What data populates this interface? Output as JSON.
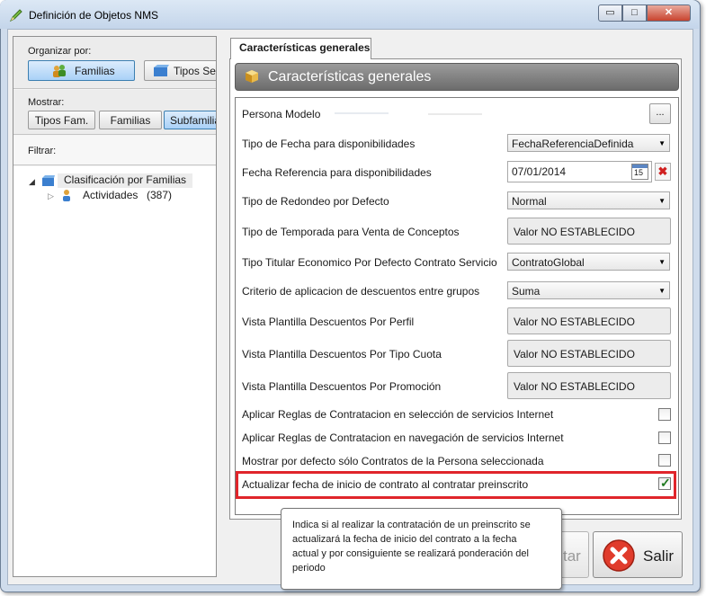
{
  "window": {
    "title": "Definición de Objetos NMS",
    "min_label": "▭",
    "max_label": "□",
    "close_label": "✕"
  },
  "left": {
    "organizar_label": "Organizar por:",
    "organizar_buttons": [
      "Familias",
      "Tipos Ser"
    ],
    "mostrar_label": "Mostrar:",
    "mostrar_buttons": [
      "Tipos Fam.",
      "Familias",
      "Subfamilia"
    ],
    "filtrar_label": "Filtrar:",
    "tree": {
      "root": "Clasificación por Familias",
      "child_name": "Actividades",
      "child_count": "(387)"
    }
  },
  "tab": {
    "label": "Características generales"
  },
  "panel": {
    "header": "Características generales",
    "persona_modelo": {
      "label": "Persona Modelo",
      "button": "..."
    },
    "tipo_fecha": {
      "label": "Tipo de Fecha para disponibilidades",
      "value": "FechaReferenciaDefinida"
    },
    "fecha_referencia": {
      "label": "Fecha Referencia para disponibilidades",
      "value": "07/01/2014",
      "calendar_day": "15"
    },
    "tipo_redondeo": {
      "label": "Tipo de Redondeo por Defecto",
      "value": "Normal"
    },
    "tipo_temporada": {
      "label": "Tipo de Temporada para Venta de Conceptos",
      "value": "Valor NO ESTABLECIDO"
    },
    "tipo_titular": {
      "label": "Tipo Titular Economico Por Defecto Contrato Servicio",
      "value": "ContratoGlobal"
    },
    "criterio_descuentos": {
      "label": "Criterio de aplicacion de descuentos entre grupos",
      "value": "Suma"
    },
    "vista_perfil": {
      "label": "Vista Plantilla Descuentos Por Perfil",
      "value": "Valor NO ESTABLECIDO"
    },
    "vista_cuota": {
      "label": "Vista Plantilla Descuentos Por Tipo Cuota",
      "value": "Valor NO ESTABLECIDO"
    },
    "vista_promocion": {
      "label": "Vista Plantilla Descuentos Por Promoción",
      "value": "Valor NO ESTABLECIDO"
    },
    "reglas_seleccion": {
      "label": "Aplicar Reglas de Contratacion en selección de servicios Internet",
      "checked": false
    },
    "reglas_navegacion": {
      "label": "Aplicar Reglas de Contratacion en navegación de servicios Internet",
      "checked": false
    },
    "mostrar_contratos": {
      "label": "Mostrar por defecto sólo Contratos de la Persona seleccionada",
      "checked": false
    },
    "actualizar_fecha": {
      "label": "Actualizar fecha de inicio de contrato al contratar preinscrito",
      "checked": true
    }
  },
  "footer": {
    "hidden_button_fragment": "tar",
    "salir_label": "Salir"
  },
  "tooltip": {
    "lines": [
      "Indica si al realizar la contratación de un preinscrito se",
      "actualizará la fecha de inicio del contrato a la fecha",
      "actual y por consiguiente se realizará ponderación del",
      "periodo"
    ]
  },
  "colors": {
    "accent_highlight": "#e0252b",
    "selected_button": "#a9d1f7",
    "header_gray": "#7a7a7a",
    "check_green": "#1f7a1f"
  }
}
